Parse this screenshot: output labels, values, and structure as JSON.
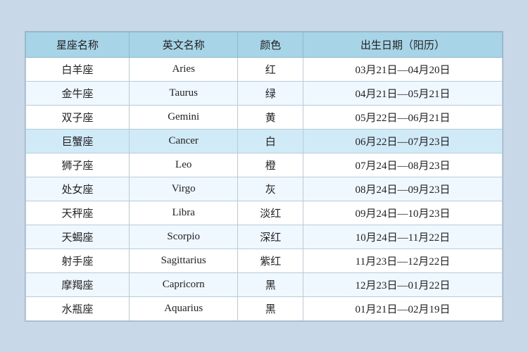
{
  "table": {
    "headers": [
      "星座名称",
      "英文名称",
      "颜色",
      "出生日期（阳历）"
    ],
    "rows": [
      {
        "chinese": "白羊座",
        "english": "Aries",
        "color": "红",
        "dates": "03月21日—04月20日",
        "highlight": false
      },
      {
        "chinese": "金牛座",
        "english": "Taurus",
        "color": "绿",
        "dates": "04月21日—05月21日",
        "highlight": false
      },
      {
        "chinese": "双子座",
        "english": "Gemini",
        "color": "黄",
        "dates": "05月22日—06月21日",
        "highlight": false
      },
      {
        "chinese": "巨蟹座",
        "english": "Cancer",
        "color": "白",
        "dates": "06月22日—07月23日",
        "highlight": true
      },
      {
        "chinese": "狮子座",
        "english": "Leo",
        "color": "橙",
        "dates": "07月24日—08月23日",
        "highlight": false
      },
      {
        "chinese": "处女座",
        "english": "Virgo",
        "color": "灰",
        "dates": "08月24日—09月23日",
        "highlight": false
      },
      {
        "chinese": "天秤座",
        "english": "Libra",
        "color": "淡红",
        "dates": "09月24日—10月23日",
        "highlight": false
      },
      {
        "chinese": "天蝎座",
        "english": "Scorpio",
        "color": "深红",
        "dates": "10月24日—11月22日",
        "highlight": false
      },
      {
        "chinese": "射手座",
        "english": "Sagittarius",
        "color": "紫红",
        "dates": "11月23日—12月22日",
        "highlight": false
      },
      {
        "chinese": "摩羯座",
        "english": "Capricorn",
        "color": "黑",
        "dates": "12月23日—01月22日",
        "highlight": false
      },
      {
        "chinese": "水瓶座",
        "english": "Aquarius",
        "color": "黑",
        "dates": "01月21日—02月19日",
        "highlight": false
      }
    ]
  }
}
